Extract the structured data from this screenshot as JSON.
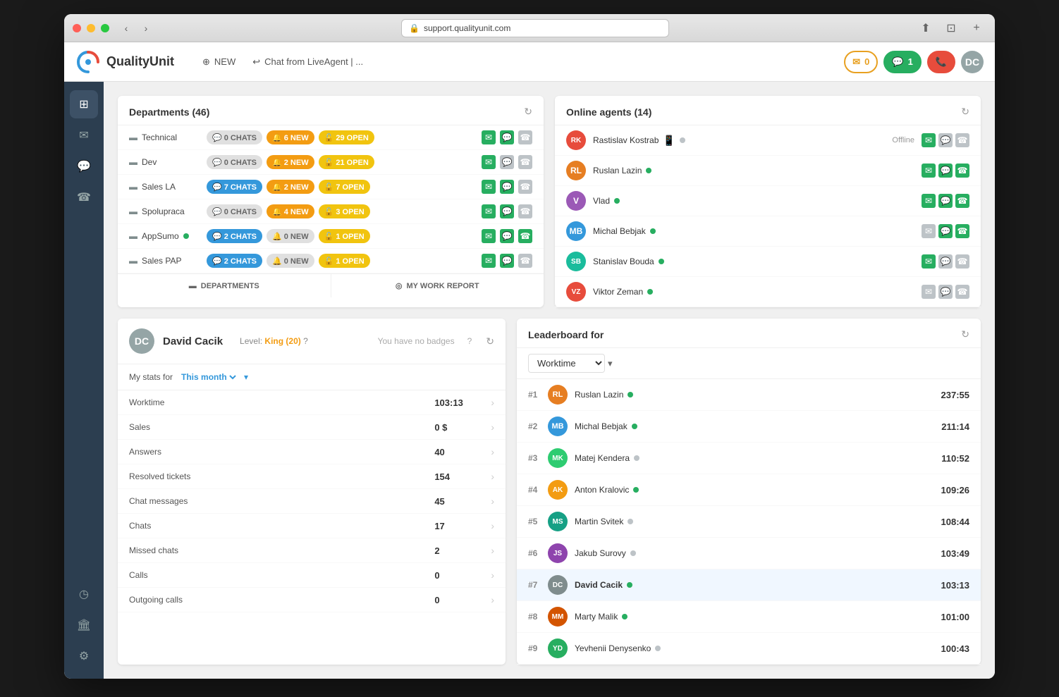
{
  "window": {
    "url": "support.qualityunit.com"
  },
  "header": {
    "logo_text": "QualityUnit",
    "nav": [
      {
        "label": "NEW",
        "icon": "⊕"
      },
      {
        "label": "Chat from LiveAgent | ...",
        "icon": "↩"
      }
    ],
    "email_badge": "0",
    "chat_badge": "1",
    "call_icon": "📞"
  },
  "sidebar": {
    "items": [
      {
        "icon": "⊞",
        "label": "dashboard",
        "active": true
      },
      {
        "icon": "✉",
        "label": "tickets"
      },
      {
        "icon": "💬",
        "label": "chat"
      },
      {
        "icon": "☎",
        "label": "calls"
      },
      {
        "icon": "◷",
        "label": "reports"
      },
      {
        "icon": "🏛",
        "label": "knowledge"
      },
      {
        "icon": "⚙",
        "label": "settings"
      }
    ]
  },
  "departments": {
    "title": "Departments (46)",
    "rows": [
      {
        "name": "Technical",
        "chats": "0 CHATS",
        "new": "6 NEW",
        "open": "29 OPEN",
        "email_active": true,
        "chat_active": true,
        "phone_active": false
      },
      {
        "name": "Dev",
        "chats": "0 CHATS",
        "new": "2 NEW",
        "open": "21 OPEN",
        "email_active": true,
        "chat_active": false,
        "phone_active": false
      },
      {
        "name": "Sales LA",
        "chats": "7 CHATS",
        "new": "2 NEW",
        "open": "7 OPEN",
        "email_active": true,
        "chat_active": true,
        "phone_active": false
      },
      {
        "name": "Spolupraca",
        "chats": "0 CHATS",
        "new": "4 NEW",
        "open": "3 OPEN",
        "email_active": true,
        "chat_active": true,
        "phone_active": false
      },
      {
        "name": "AppSumo",
        "chats": "2 CHATS",
        "new": "0 NEW",
        "open": "1 OPEN",
        "email_active": true,
        "chat_active": true,
        "phone_active": true,
        "has_dot": true
      },
      {
        "name": "Sales PAP",
        "chats": "2 CHATS",
        "new": "0 NEW",
        "open": "1 OPEN",
        "email_active": true,
        "chat_active": true,
        "phone_active": false
      }
    ],
    "footer_dept": "DEPARTMENTS",
    "footer_report": "MY WORK REPORT"
  },
  "online_agents": {
    "title": "Online agents (14)",
    "agents": [
      {
        "name": "Rastislav Kostrab",
        "status": "Offline",
        "online": false,
        "initials": "RK",
        "color": "#e74c3c",
        "email": true,
        "chat": false,
        "phone": false
      },
      {
        "name": "Ruslan Lazin",
        "status": "",
        "online": true,
        "initials": "RL",
        "color": "#e67e22",
        "email": true,
        "chat": true,
        "phone": true
      },
      {
        "name": "Vlad",
        "status": "",
        "online": true,
        "initials": "V",
        "color": "#9b59b6",
        "email": true,
        "chat": true,
        "phone": true
      },
      {
        "name": "Michal Bebjak",
        "status": "",
        "online": true,
        "initials": "MB",
        "color": "#3498db",
        "email": false,
        "chat": true,
        "phone": true
      },
      {
        "name": "Stanislav Bouda",
        "status": "",
        "online": true,
        "initials": "SB",
        "color": "#1abc9c",
        "email": true,
        "chat": false,
        "phone": false
      },
      {
        "name": "Viktor Zeman",
        "status": "",
        "online": true,
        "initials": "VZ",
        "color": "#e74c3c",
        "email": false,
        "chat": false,
        "phone": false
      }
    ]
  },
  "user_stats": {
    "name": "David Cacik",
    "level": "King (20)",
    "badges_text": "You have no badges",
    "period_label": "My stats for",
    "period": "This month",
    "rows": [
      {
        "label": "Worktime",
        "value": "103:13"
      },
      {
        "label": "Sales",
        "value": "0 $"
      },
      {
        "label": "Answers",
        "value": "40"
      },
      {
        "label": "Resolved tickets",
        "value": "154"
      },
      {
        "label": "Chat messages",
        "value": "45"
      },
      {
        "label": "Chats",
        "value": "17"
      },
      {
        "label": "Missed chats",
        "value": "2"
      },
      {
        "label": "Calls",
        "value": "0"
      },
      {
        "label": "Outgoing calls",
        "value": "0"
      }
    ]
  },
  "leaderboard": {
    "title": "Leaderboard for",
    "filter": "Worktime",
    "rows": [
      {
        "rank": "#1",
        "name": "Ruslan Lazin",
        "online": true,
        "score": "237:55",
        "initials": "RL",
        "color": "#e67e22",
        "highlighted": false
      },
      {
        "rank": "#2",
        "name": "Michal Bebjak",
        "online": true,
        "score": "211:14",
        "initials": "MB",
        "color": "#3498db",
        "highlighted": false
      },
      {
        "rank": "#3",
        "name": "Matej Kendera",
        "online": false,
        "score": "110:52",
        "initials": "MK",
        "color": "#2ecc71",
        "highlighted": false
      },
      {
        "rank": "#4",
        "name": "Anton Kralovic",
        "online": true,
        "score": "109:26",
        "initials": "AK",
        "color": "#f39c12",
        "highlighted": false
      },
      {
        "rank": "#5",
        "name": "Martin Svitek",
        "online": false,
        "score": "108:44",
        "initials": "MS",
        "color": "#16a085",
        "highlighted": false
      },
      {
        "rank": "#6",
        "name": "Jakub Surovy",
        "online": false,
        "score": "103:49",
        "initials": "JS",
        "color": "#8e44ad",
        "highlighted": false
      },
      {
        "rank": "#7",
        "name": "David Cacik",
        "online": true,
        "score": "103:13",
        "initials": "DC",
        "color": "#7f8c8d",
        "highlighted": true
      },
      {
        "rank": "#8",
        "name": "Marty Malik",
        "online": true,
        "score": "101:00",
        "initials": "MM",
        "color": "#d35400",
        "highlighted": false
      },
      {
        "rank": "#9",
        "name": "Yevhenii Denysenko",
        "online": false,
        "score": "100:43",
        "initials": "YD",
        "color": "#27ae60",
        "highlighted": false
      }
    ]
  }
}
